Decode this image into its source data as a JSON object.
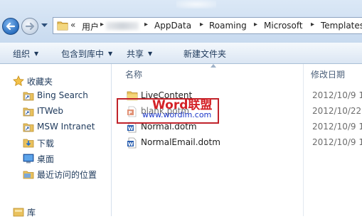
{
  "address": {
    "crumbs": [
      "用户",
      "AppData",
      "Roaming",
      "Microsoft",
      "Templates"
    ],
    "overflow_marker": "«"
  },
  "toolbar": {
    "organize": "组织",
    "include_in_library": "包含到库中",
    "share": "共享",
    "new_folder": "新建文件夹"
  },
  "nav": {
    "favorites_label": "收藏夹",
    "items": [
      {
        "label": "Bing Search",
        "icon": "shortcut-folder-icon"
      },
      {
        "label": "ITWeb",
        "icon": "shortcut-folder-icon"
      },
      {
        "label": "MSW Intranet",
        "icon": "shortcut-folder-icon"
      },
      {
        "label": "下载",
        "icon": "downloads-folder-icon"
      },
      {
        "label": "桌面",
        "icon": "desktop-icon"
      },
      {
        "label": "最近访问的位置",
        "icon": "recent-places-icon"
      }
    ],
    "libraries_label": "库"
  },
  "columns": {
    "name": "名称",
    "date": "修改日期"
  },
  "files": [
    {
      "name": "LiveContent",
      "date": "2012/10/9 1",
      "icon": "folder-icon"
    },
    {
      "name": "blank.potm",
      "date": "2012/10/22",
      "icon": "powerpoint-template-icon"
    },
    {
      "name": "Normal.dotm",
      "date": "2012/10/9 1",
      "icon": "word-template-icon"
    },
    {
      "name": "NormalEmail.dotm",
      "date": "2012/10/9 1",
      "icon": "word-template-icon"
    }
  ],
  "watermark": {
    "logo": "Word联盟",
    "url": "www.wordlm.com"
  },
  "colors": {
    "accent": "#1e395b",
    "highlight_border": "#c0232b",
    "watermark_red": "#d42126",
    "watermark_blue": "#1a35c8"
  }
}
